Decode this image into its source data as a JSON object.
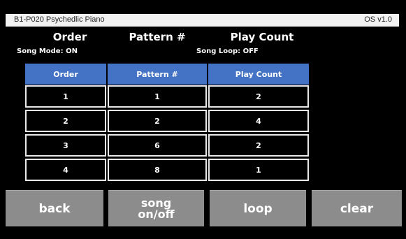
{
  "title_bar": {
    "patch_name": "B1-P020 Psychedlic Piano",
    "os_version": "OS v1.0"
  },
  "headers": {
    "order": "Order",
    "pattern": "Pattern #",
    "play_count": "Play Count"
  },
  "status": {
    "song_mode": "Song Mode: ON",
    "song_loop": "Song Loop: OFF"
  },
  "table": {
    "columns": [
      "Order",
      "Pattern #",
      "Play Count"
    ],
    "rows": [
      [
        "1",
        "1",
        "2"
      ],
      [
        "2",
        "2",
        "4"
      ],
      [
        "3",
        "6",
        "2"
      ],
      [
        "4",
        "8",
        "1"
      ]
    ]
  },
  "buttons": {
    "back": "back",
    "song": "song on/off",
    "loop": "loop",
    "clear": "clear"
  },
  "colors": {
    "header_blue": "#4472c4",
    "button_gray": "#8c8c8c",
    "background": "#000000"
  }
}
